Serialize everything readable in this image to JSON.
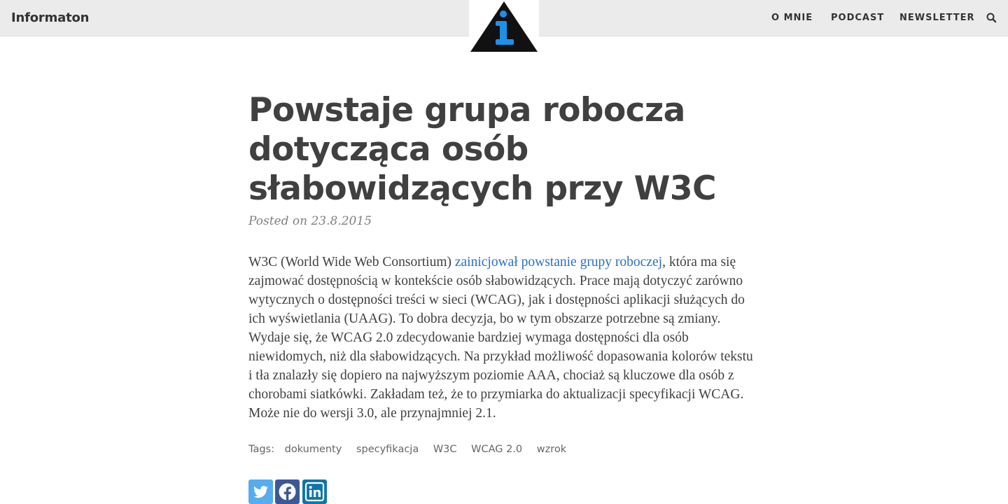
{
  "header": {
    "brand": "Informaton",
    "nav": [
      "O MNIE",
      "PODCAST",
      "NEWSLETTER"
    ],
    "search_icon": "search-icon",
    "logo_icon": "info-triangle-icon"
  },
  "article": {
    "title": "Powstaje grupa robocza dotycząca osób słabowidzących przy W3C",
    "posted_label": "Posted on",
    "posted_date": "23.8.2015",
    "body_intro": "W3C (World Wide Web Consortium) ",
    "body_link": "zainicjował powstanie grupy roboczej",
    "body_rest": ", która ma się zajmować dostępnością w kontekście osób słabowidzących. Prace mają dotyczyć zarówno wytycznych o dostępności treści w sieci (WCAG), jak i dostępności aplikacji służących do ich wyświetlania (UAAG). To dobra decyzja, bo w tym obszarze potrzebne są zmiany. Wydaje się, że WCAG 2.0 zdecydowanie bardziej wymaga dostępności dla osób niewidomych, niż dla słabowidzących. Na przykład możliwość dopasowania kolorów tekstu i tła znalazły się dopiero na najwyższym poziomie AAA, chociaż są kluczowe dla osób z chorobami siatkówki. Zakładam też, że to przymiarka do aktualizacji specyfikacji WCAG. Może nie do wersji 3.0, ale przynajmniej 2.1.",
    "tags_label": "Tags:",
    "tags": [
      "dokumenty",
      "specyfikacja",
      "W3C",
      "WCAG 2.0",
      "wzrok"
    ]
  },
  "share": {
    "icons": [
      "twitter-icon",
      "facebook-icon",
      "linkedin-icon"
    ],
    "colors": {
      "twitter": "#55acee",
      "facebook": "#3b5998",
      "linkedin": "#0e76a8"
    }
  },
  "colors": {
    "link": "#2a6fc9",
    "text": "#404040",
    "header_bg": "#ebebeb"
  }
}
